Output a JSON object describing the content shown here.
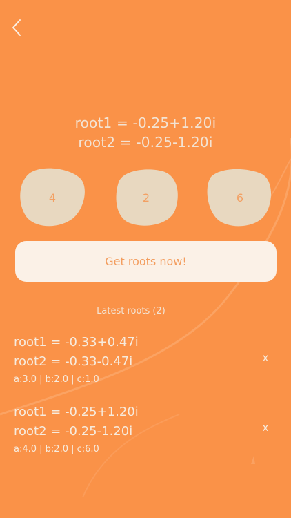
{
  "nav": {
    "back_icon": "chevron-left-icon"
  },
  "result": {
    "root1": "root1 = -0.25+1.20i",
    "root2": "root2 = -0.25-1.20i"
  },
  "coefficients": {
    "a": "4",
    "b": "2",
    "c": "6"
  },
  "actions": {
    "get_roots_label": "Get roots now!"
  },
  "history": {
    "title": "Latest roots (2)",
    "delete_label": "x",
    "entries": [
      {
        "root1": "root1 = -0.33+0.47i",
        "root2": "root2 = -0.33-0.47i",
        "coeffs": "a:3.0 | b:2.0 | c:1.0"
      },
      {
        "root1": "root1 = -0.25+1.20i",
        "root2": "root2 = -0.25-1.20i",
        "coeffs": "a:4.0 | b:2.0 | c:6.0"
      }
    ]
  },
  "colors": {
    "background": "#FA9248",
    "blob_fill": "#E8D8C0",
    "button_bg": "#FBF1E7",
    "accent_text": "#F39D5E",
    "light_text": "#F3E3D3"
  }
}
